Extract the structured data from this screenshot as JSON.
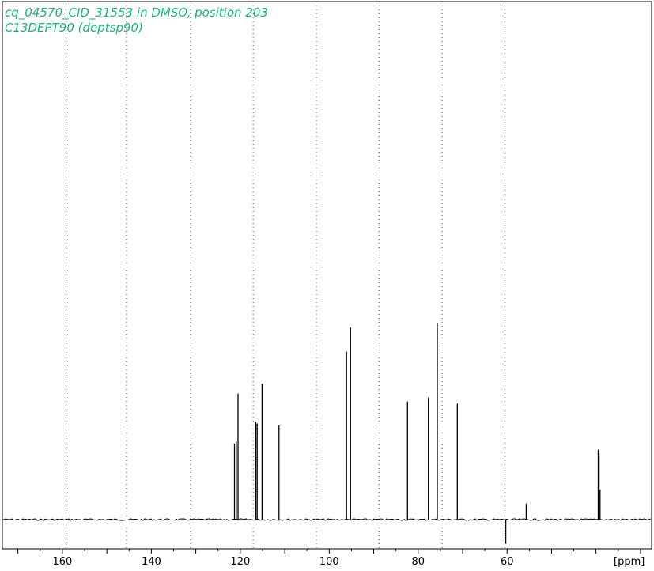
{
  "chart_data": {
    "type": "line",
    "title_lines": [
      "cq_04570_CID_31553 in DMSO, position 203",
      "C13DEPT90 (deptsp90)"
    ],
    "x_unit_label": "[ppm]",
    "x_ticks": [
      160,
      140,
      120,
      100,
      80,
      60
    ],
    "x_range": [
      173.5,
      27.5
    ],
    "x_reversed": true,
    "grid": true,
    "grid_lines_ppm": [
      159.2,
      145.6,
      131.2,
      117.1,
      102.9,
      88.8,
      74.6,
      60.5
    ],
    "y_range": [
      -0.12,
      1.0
    ],
    "peaks": [
      {
        "ppm": 121.3,
        "height": 0.38
      },
      {
        "ppm": 120.9,
        "height": 0.39
      },
      {
        "ppm": 120.5,
        "height": 0.63
      },
      {
        "ppm": 116.5,
        "height": 0.49
      },
      {
        "ppm": 116.2,
        "height": 0.48
      },
      {
        "ppm": 115.1,
        "height": 0.68
      },
      {
        "ppm": 111.3,
        "height": 0.47
      },
      {
        "ppm": 96.1,
        "height": 0.84
      },
      {
        "ppm": 95.2,
        "height": 0.96
      },
      {
        "ppm": 82.4,
        "height": 0.59
      },
      {
        "ppm": 77.7,
        "height": 0.61
      },
      {
        "ppm": 75.7,
        "height": 0.98
      },
      {
        "ppm": 71.2,
        "height": 0.58
      },
      {
        "ppm": 60.3,
        "height": -0.12
      },
      {
        "ppm": 55.7,
        "height": 0.08
      },
      {
        "ppm": 39.5,
        "height": 0.35
      },
      {
        "ppm": 39.3,
        "height": 0.33
      },
      {
        "ppm": 39.1,
        "height": 0.15
      }
    ],
    "colors": {
      "title": "#1fb079",
      "trace": "#000000",
      "grid": "#555555",
      "axis": "#000000"
    }
  }
}
